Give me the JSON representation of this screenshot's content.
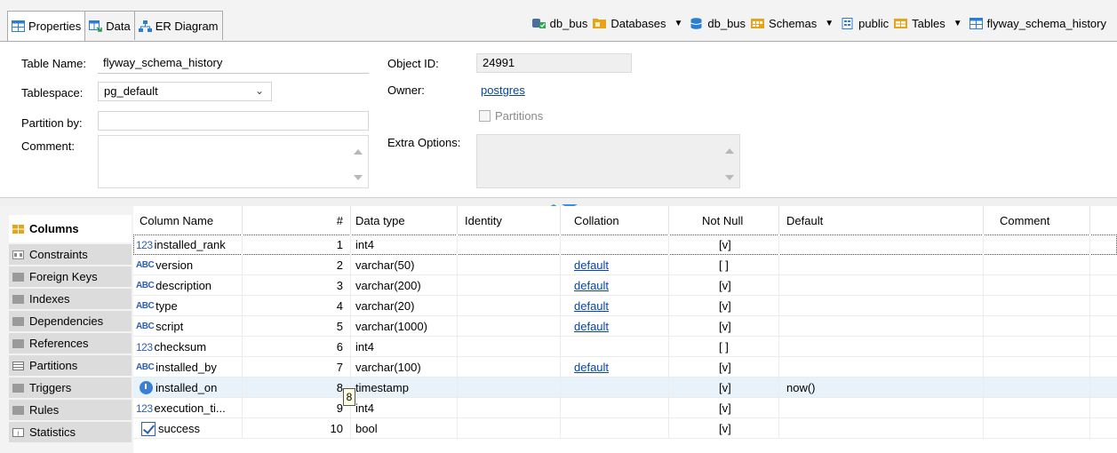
{
  "tabs": [
    {
      "label": "Properties",
      "icon": "table-icon",
      "active": true
    },
    {
      "label": "Data",
      "icon": "data-icon",
      "active": false
    },
    {
      "label": "ER Diagram",
      "icon": "er-diagram-icon",
      "active": false
    }
  ],
  "breadcrumb": {
    "connection": "db_bus",
    "databases": "Databases",
    "database": "db_bus",
    "schemas": "Schemas",
    "schema": "public",
    "tables": "Tables",
    "table": "flyway_schema_history"
  },
  "form": {
    "table_name_label": "Table Name:",
    "table_name_value": "flyway_schema_history",
    "tablespace_label": "Tablespace:",
    "tablespace_value": "pg_default",
    "partition_by_label": "Partition by:",
    "partition_by_value": "",
    "comment_label": "Comment:",
    "comment_value": "",
    "object_id_label": "Object ID:",
    "object_id_value": "24991",
    "owner_label": "Owner:",
    "owner_value": "postgres",
    "partitions_label": "Partitions",
    "extra_options_label": "Extra Options:",
    "extra_options_value": ""
  },
  "side_tabs": [
    {
      "label": "Columns",
      "active": true
    },
    {
      "label": "Constraints",
      "active": false
    },
    {
      "label": "Foreign Keys",
      "active": false
    },
    {
      "label": "Indexes",
      "active": false
    },
    {
      "label": "Dependencies",
      "active": false
    },
    {
      "label": "References",
      "active": false
    },
    {
      "label": "Partitions",
      "active": false
    },
    {
      "label": "Triggers",
      "active": false
    },
    {
      "label": "Rules",
      "active": false
    },
    {
      "label": "Statistics",
      "active": false
    }
  ],
  "grid": {
    "headers": [
      "Column Name",
      "#",
      "Data type",
      "Identity",
      "Collation",
      "Not Null",
      "Default",
      "Comment"
    ],
    "rows": [
      {
        "type_icon": "123",
        "name": "installed_rank",
        "num": "1",
        "data_type": "int4",
        "identity": "",
        "collation": "",
        "not_null": "[v]",
        "default": "",
        "comment": ""
      },
      {
        "type_icon": "ABC",
        "name": "version",
        "num": "2",
        "data_type": "varchar(50)",
        "identity": "",
        "collation": "default",
        "not_null": "[ ]",
        "default": "",
        "comment": ""
      },
      {
        "type_icon": "ABC",
        "name": "description",
        "num": "3",
        "data_type": "varchar(200)",
        "identity": "",
        "collation": "default",
        "not_null": "[v]",
        "default": "",
        "comment": ""
      },
      {
        "type_icon": "ABC",
        "name": "type",
        "num": "4",
        "data_type": "varchar(20)",
        "identity": "",
        "collation": "default",
        "not_null": "[v]",
        "default": "",
        "comment": ""
      },
      {
        "type_icon": "ABC",
        "name": "script",
        "num": "5",
        "data_type": "varchar(1000)",
        "identity": "",
        "collation": "default",
        "not_null": "[v]",
        "default": "",
        "comment": ""
      },
      {
        "type_icon": "123",
        "name": "checksum",
        "num": "6",
        "data_type": "int4",
        "identity": "",
        "collation": "",
        "not_null": "[ ]",
        "default": "",
        "comment": ""
      },
      {
        "type_icon": "ABC",
        "name": "installed_by",
        "num": "7",
        "data_type": "varchar(100)",
        "identity": "",
        "collation": "default",
        "not_null": "[v]",
        "default": "",
        "comment": ""
      },
      {
        "type_icon": "clock",
        "name": "installed_on",
        "num": "8",
        "data_type": "timestamp",
        "identity": "",
        "collation": "",
        "not_null": "[v]",
        "default": "now()",
        "comment": ""
      },
      {
        "type_icon": "123",
        "name": "execution_ti...",
        "num": "9",
        "data_type": "int4",
        "identity": "",
        "collation": "",
        "not_null": "[v]",
        "default": "",
        "comment": ""
      },
      {
        "type_icon": "check",
        "name": "success",
        "num": "10",
        "data_type": "bool",
        "identity": "",
        "collation": "",
        "not_null": "[v]",
        "default": "",
        "comment": ""
      }
    ],
    "tooltip": "8"
  },
  "colors": {
    "accent": "#3a8ee6",
    "link": "#0645ad",
    "selected_row": "#e8f2fb",
    "tab_bg": "#f3f3f3",
    "sidetab_bg": "#dcdcdc"
  }
}
